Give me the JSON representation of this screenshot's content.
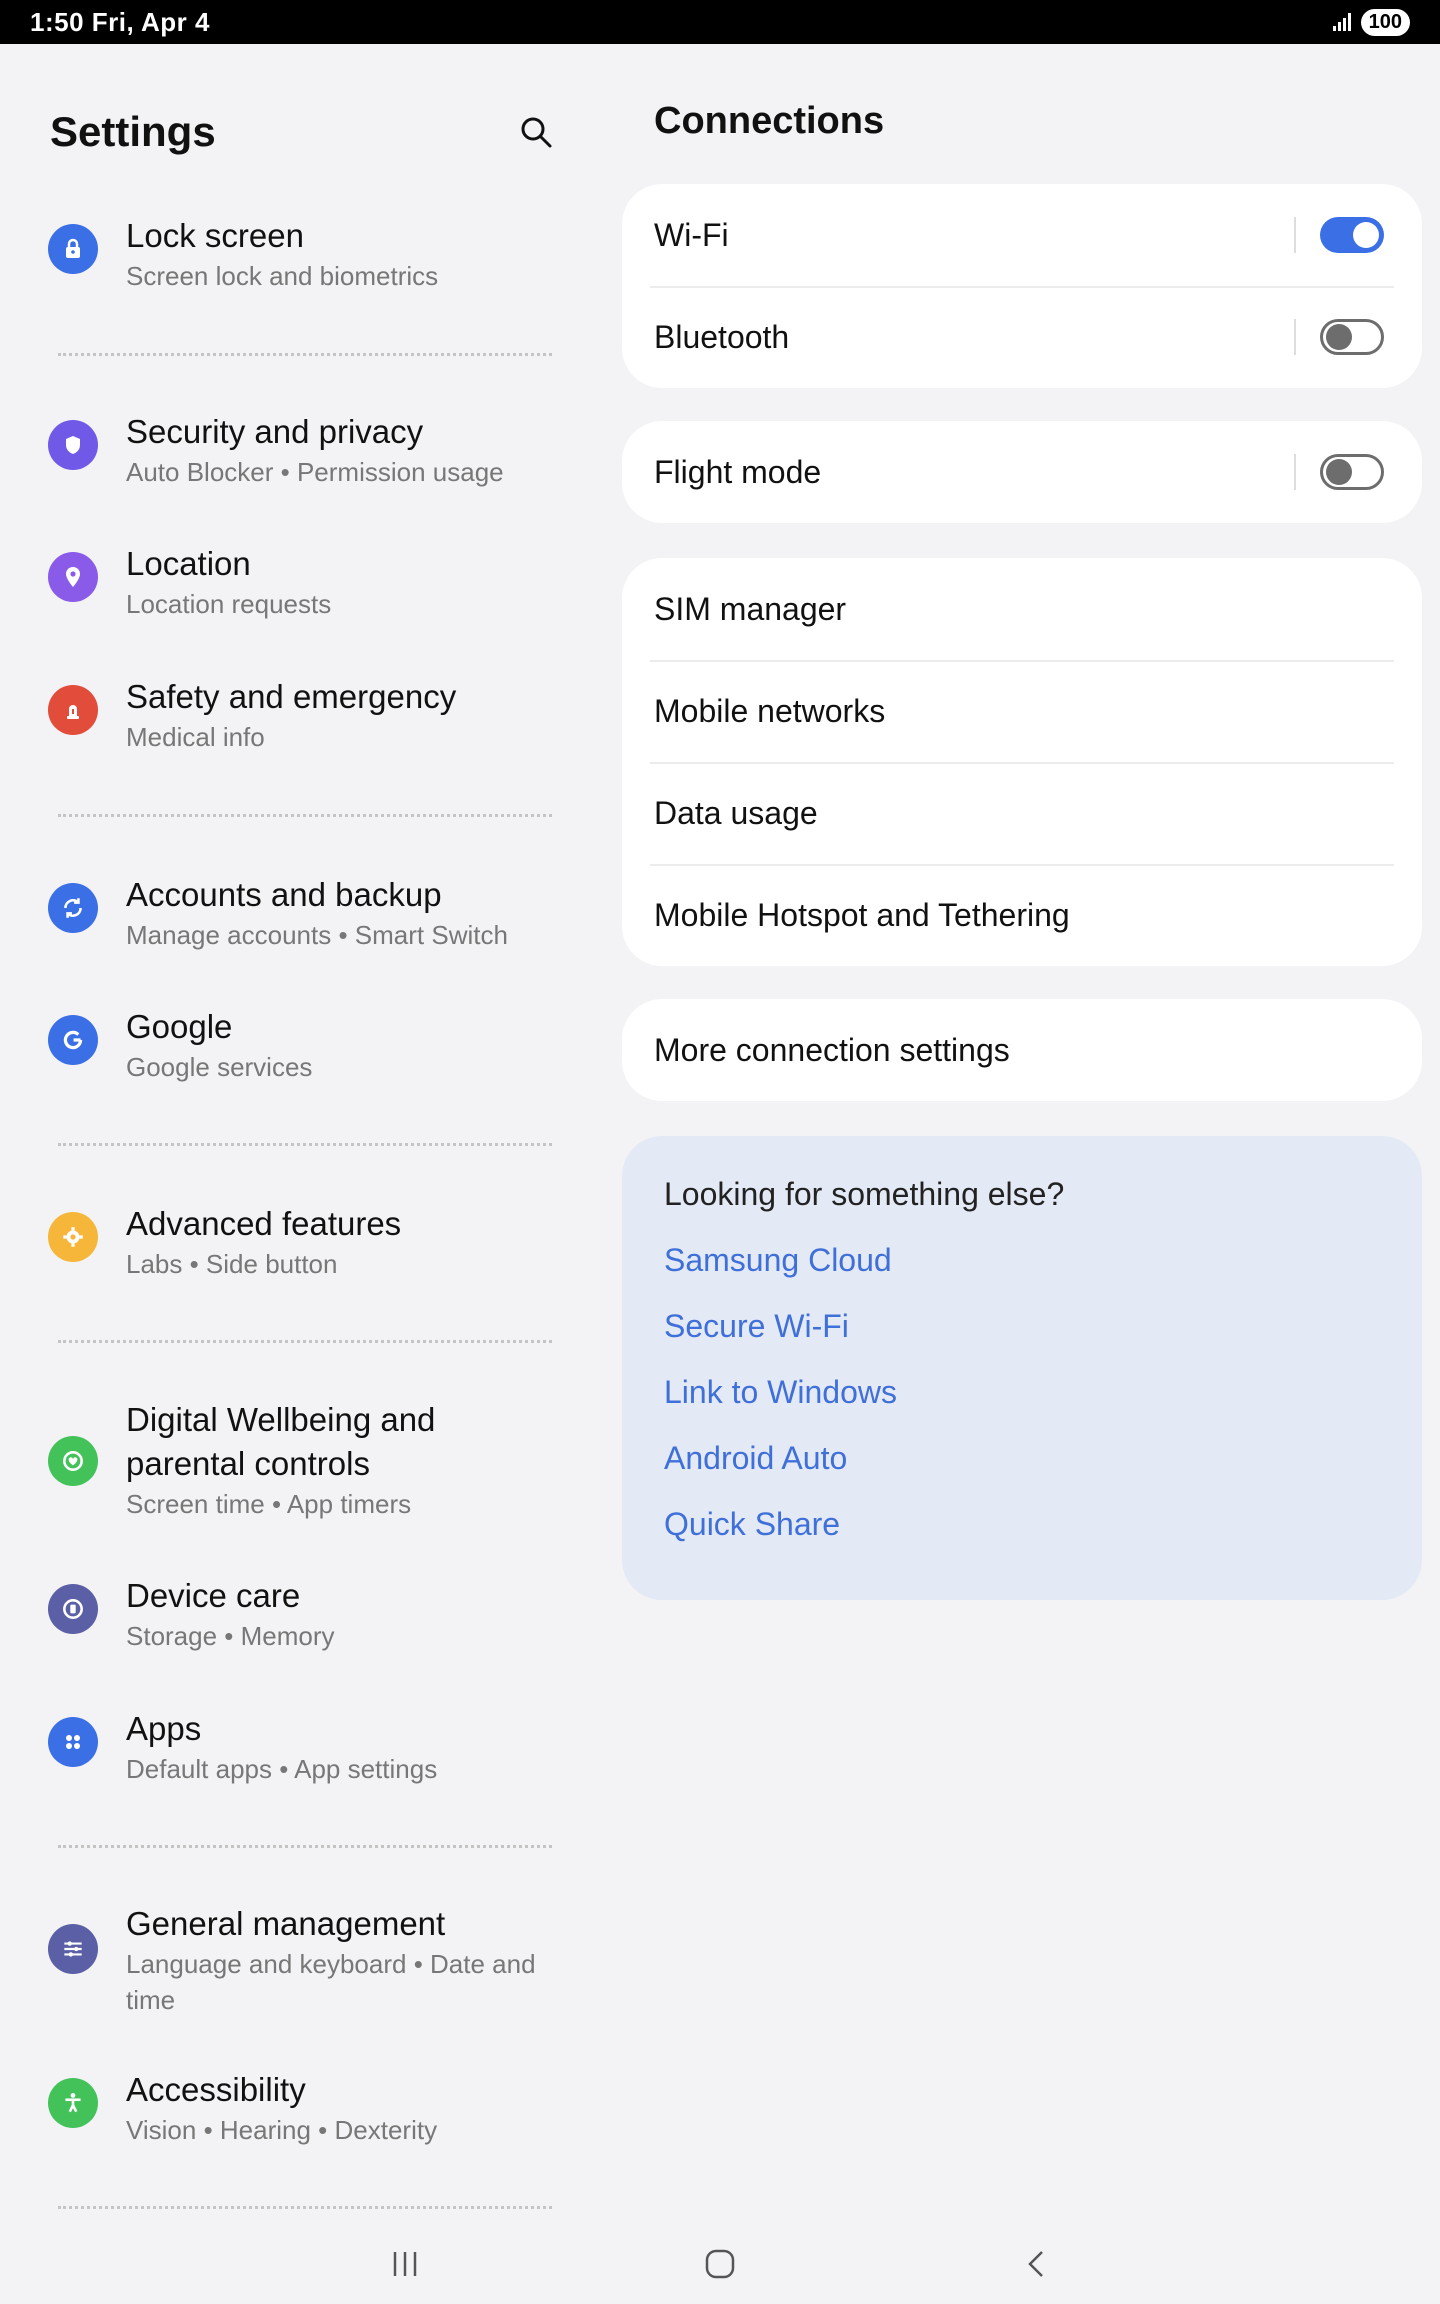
{
  "status_bar": {
    "time_date": "1:50  Fri, Apr 4",
    "battery": "100"
  },
  "left": {
    "title": "Settings",
    "items": [
      {
        "title": "Lock screen",
        "subtitle": "Screen lock and biometrics",
        "icon": "lock-icon",
        "color": "#3b6fe6"
      },
      {
        "title": "Security and privacy",
        "subtitle": "Auto Blocker  •  Permission usage",
        "icon": "shield-icon",
        "color": "#7159e8"
      },
      {
        "title": "Location",
        "subtitle": "Location requests",
        "icon": "location-pin-icon",
        "color": "#8a5ae8"
      },
      {
        "title": "Safety and emergency",
        "subtitle": "Medical info",
        "icon": "emergency-icon",
        "color": "#e24c3b"
      },
      {
        "title": "Accounts and backup",
        "subtitle": "Manage accounts  •  Smart Switch",
        "icon": "sync-icon",
        "color": "#3b6fe6"
      },
      {
        "title": "Google",
        "subtitle": "Google services",
        "icon": "google-icon",
        "color": "#3b6fe6"
      },
      {
        "title": "Advanced features",
        "subtitle": "Labs  •  Side button",
        "icon": "advanced-features-icon",
        "color": "#f6b63a"
      },
      {
        "title": "Digital Wellbeing and",
        "title2": "parental controls",
        "subtitle": "Screen time  •  App timers",
        "icon": "wellbeing-icon",
        "color": "#43c25a"
      },
      {
        "title": "Device care",
        "subtitle": "Storage  •  Memory",
        "icon": "device-care-icon",
        "color": "#5a5fa6"
      },
      {
        "title": "Apps",
        "subtitle": "Default apps  •  App settings",
        "icon": "apps-grid-icon",
        "color": "#3b6fe6"
      },
      {
        "title": "General management",
        "subtitle": "Language and keyboard  •  Date and",
        "subtitle2": "time",
        "icon": "sliders-icon",
        "color": "#5a5fa6"
      },
      {
        "title": "Accessibility",
        "subtitle": "Vision  •  Hearing  •  Dexterity",
        "icon": "accessibility-icon",
        "color": "#43c25a"
      }
    ]
  },
  "right": {
    "title": "Connections",
    "card1": [
      {
        "label": "Wi-Fi",
        "toggle": true
      },
      {
        "label": "Bluetooth",
        "toggle": false
      }
    ],
    "card2": [
      {
        "label": "Flight mode",
        "toggle": false
      }
    ],
    "card3": [
      {
        "label": "SIM manager"
      },
      {
        "label": "Mobile networks"
      },
      {
        "label": "Data usage"
      },
      {
        "label": "Mobile Hotspot and Tethering"
      }
    ],
    "card4": [
      {
        "label": "More connection settings"
      }
    ],
    "suggestions": {
      "title": "Looking for something else?",
      "links": [
        "Samsung Cloud",
        "Secure Wi-Fi",
        "Link to Windows",
        "Android Auto",
        "Quick Share"
      ]
    }
  },
  "colors": {
    "accent": "#3b6fe6",
    "link": "#3f6fd8"
  }
}
